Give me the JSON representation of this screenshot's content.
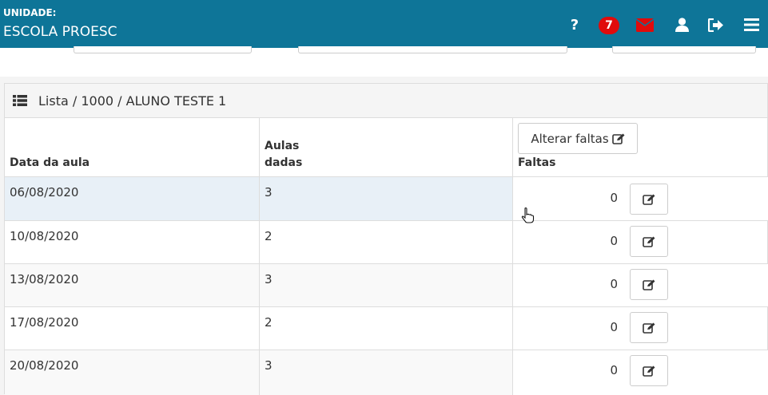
{
  "header": {
    "unit_label": "UNIDADE:",
    "unit_name": "ESCOLA PROESC",
    "help_label": "?",
    "notification_count": "7",
    "icons": [
      "question-icon",
      "envelope-icon",
      "user-icon",
      "sign-out-icon",
      "bars-menu-icon"
    ],
    "colors": {
      "bar": "#0e7598",
      "badge": "#e00b0b",
      "mail": "#e00b0b"
    }
  },
  "panel": {
    "title": "Lista / 1000 / ALUNO TESTE 1",
    "icon": "list-icon"
  },
  "table": {
    "headers": {
      "date": "Data da aula",
      "classes_line1": "Aulas",
      "classes_line2": "dadas",
      "absences": "Faltas"
    },
    "alter_button_label": "Alterar faltas",
    "rows": [
      {
        "date": "06/08/2020",
        "classes": "3",
        "absences": "0"
      },
      {
        "date": "10/08/2020",
        "classes": "2",
        "absences": "0"
      },
      {
        "date": "13/08/2020",
        "classes": "3",
        "absences": "0"
      },
      {
        "date": "17/08/2020",
        "classes": "2",
        "absences": "0"
      },
      {
        "date": "20/08/2020",
        "classes": "3",
        "absences": "0"
      }
    ]
  }
}
